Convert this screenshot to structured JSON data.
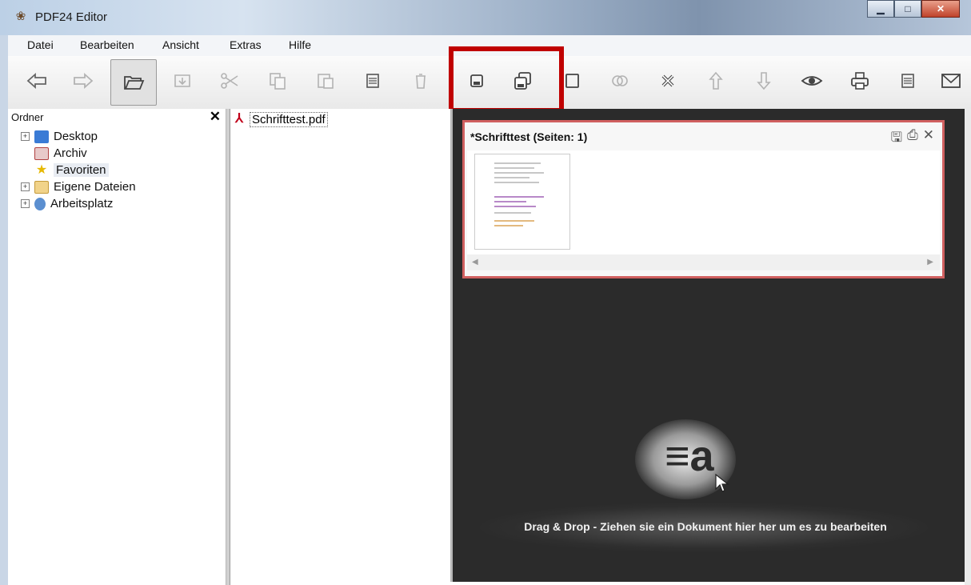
{
  "window": {
    "title": "PDF24 Editor"
  },
  "menu": {
    "items": [
      "Datei",
      "Bearbeiten",
      "Ansicht",
      "Extras",
      "Hilfe"
    ]
  },
  "folder_pane": {
    "header": "Ordner",
    "items": [
      {
        "label": "Desktop",
        "expandable": true
      },
      {
        "label": "Archiv",
        "expandable": false
      },
      {
        "label": "Favoriten",
        "expandable": false
      },
      {
        "label": "Eigene Dateien",
        "expandable": true
      },
      {
        "label": "Arbeitsplatz",
        "expandable": true
      }
    ]
  },
  "files_pane": {
    "items": [
      "Schrifttest.pdf"
    ]
  },
  "preview": {
    "doc_title": "*Schrifttest (Seiten: 1)",
    "drop_hint": "Drag & Drop - Ziehen sie ein Dokument hier her um es zu bearbeiten"
  },
  "toolbar": {
    "buttons": [
      "back-icon",
      "forward-icon",
      "open-folder-icon",
      "import-icon",
      "cut-icon",
      "copy-icon",
      "paste-icon",
      "calculator-icon",
      "trash-icon",
      "save-icon",
      "save-as-icon",
      "new-document-icon",
      "merge-icon",
      "close-document-icon",
      "move-up-icon",
      "move-down-icon",
      "preview-icon",
      "print-icon",
      "calculator-icon-2",
      "email-icon"
    ]
  },
  "colors": {
    "highlight": "#c00000",
    "preview_bg": "#2b2b2b",
    "card_border": "#d06060"
  }
}
